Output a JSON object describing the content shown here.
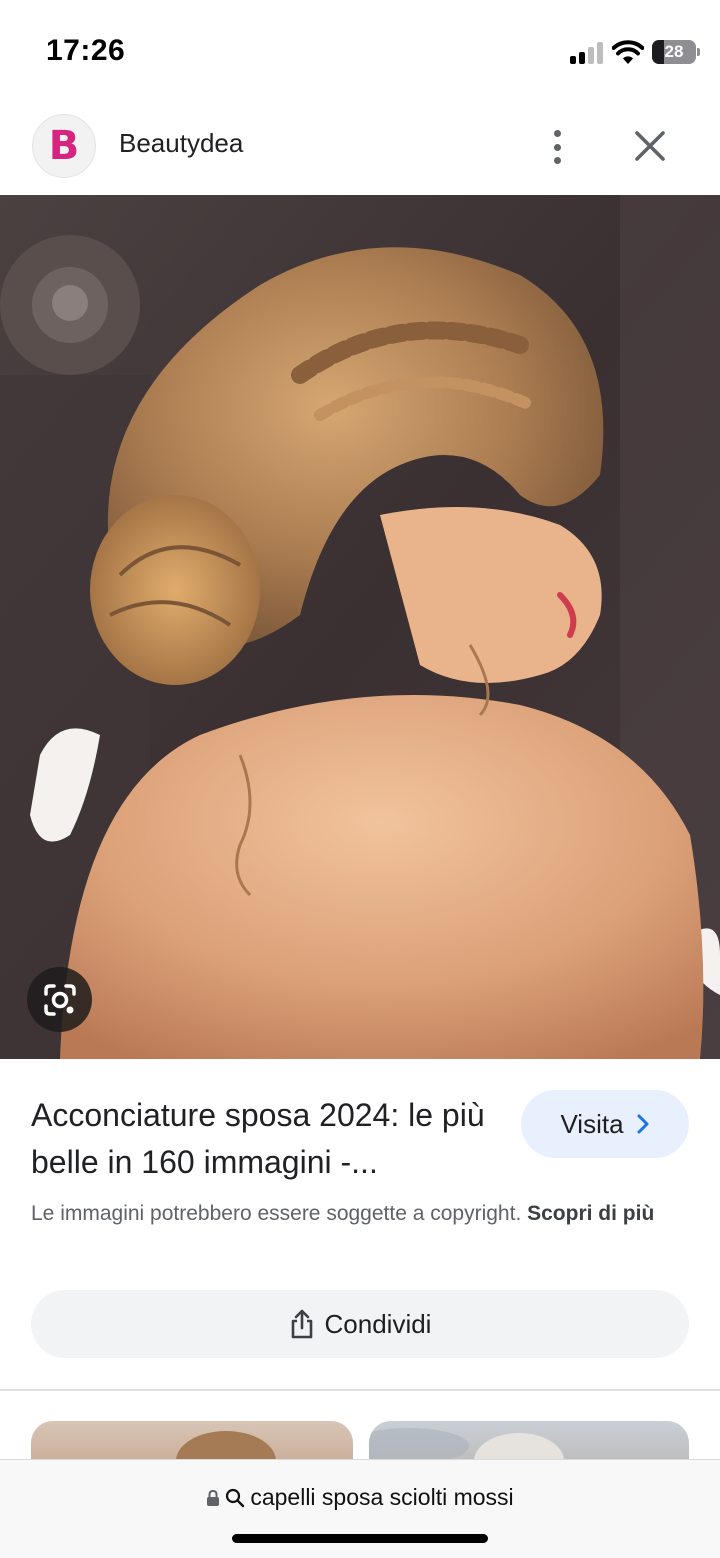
{
  "status_bar": {
    "time": "17:26",
    "battery_percent": "28",
    "battery_level": 0.28,
    "signal_bars": 2,
    "icons": [
      "signal-icon",
      "wifi-icon",
      "battery-icon"
    ]
  },
  "source": {
    "logo_letter": "B",
    "logo_color": "#d6247f",
    "name": "Beautydea",
    "icons": [
      "more-vert-icon",
      "close-icon"
    ]
  },
  "image": {
    "lens_icon": "google-lens-icon"
  },
  "result": {
    "title": "Acconciature sposa 2024: le più belle in 160 immagini -...",
    "visit_label": "Visita",
    "visit_icon": "chevron-right-icon",
    "copyright_text": "Le immagini potrebbero essere soggette a copyright. ",
    "copyright_link": "Scopri di più",
    "share_label": "Condividi",
    "share_icon": "share-icon"
  },
  "address_bar": {
    "query": "capelli sposa sciolti mossi",
    "icons": [
      "lock-icon",
      "search-icon"
    ]
  },
  "colors": {
    "visit_bg": "#e8f0fe",
    "share_bg": "#f1f3f4",
    "link_blue": "#1a73e8"
  }
}
